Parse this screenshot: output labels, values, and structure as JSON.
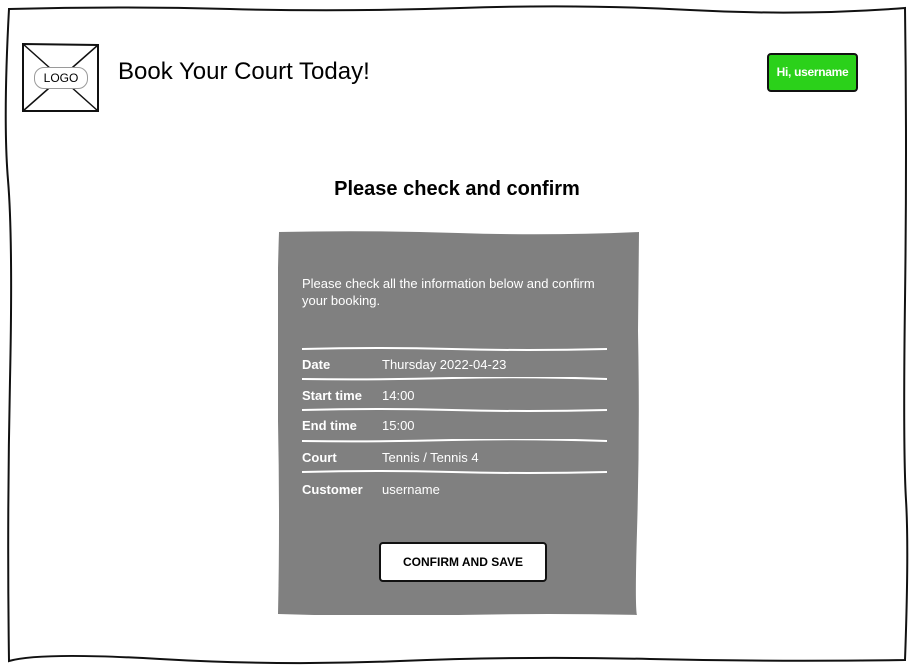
{
  "header": {
    "logo_label": "LOGO",
    "title": "Book Your Court Today!",
    "user_button_label": "Hi, username",
    "user_button_color": "#2bd11a"
  },
  "main": {
    "heading": "Please check and confirm",
    "panel": {
      "background": "#808080",
      "intro": "Please check all the information below and confirm your booking.",
      "rows": [
        {
          "label": "Date",
          "value": "Thursday 2022-04-23"
        },
        {
          "label": "Start time",
          "value": "14:00"
        },
        {
          "label": "End time",
          "value": "15:00"
        },
        {
          "label": "Court",
          "value": "Tennis / Tennis 4"
        },
        {
          "label": "Customer",
          "value": "username"
        }
      ],
      "confirm_label": "CONFIRM AND SAVE"
    }
  }
}
